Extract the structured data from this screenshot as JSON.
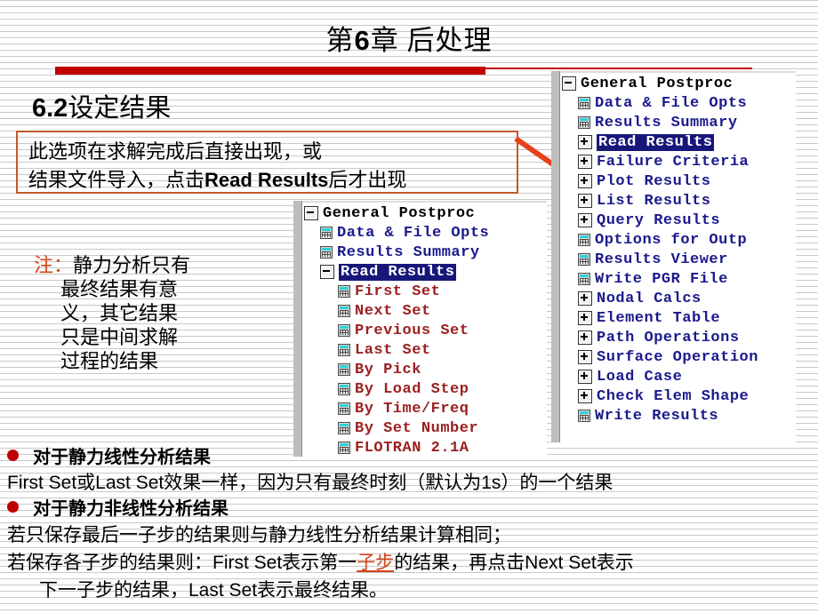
{
  "slide": {
    "title_prefix": "第",
    "title_num": "6",
    "title_suffix": "章 后处理",
    "section_num": "6.2",
    "section_text": "设定结果",
    "accent_red": "#c00000",
    "callout_border": "#c15a2b",
    "arrow_color": "#e8411a"
  },
  "callout": {
    "line1": "此选项在求解完成后直接出现，或",
    "line2_pre": "结果文件导入，点击",
    "line2_bold": "Read Results",
    "line2_post": "后才出现"
  },
  "note": {
    "mark": "注：",
    "line1": "静力分析只有",
    "line2": "最终结果有意",
    "line3": "义，其它结果",
    "line4": "只是中间求解",
    "line5": "过程的结果"
  },
  "middle_tree": {
    "rows": [
      {
        "label": "General Postproc",
        "level": 0,
        "icon": "minus-box",
        "color": "black"
      },
      {
        "label": "Data & File Opts",
        "level": 1,
        "icon": "dialog",
        "color": "blue"
      },
      {
        "label": "Results Summary",
        "level": 1,
        "icon": "dialog",
        "color": "blue"
      },
      {
        "label": "Read Results",
        "level": 1,
        "icon": "minus-box",
        "color": "selected"
      },
      {
        "label": "First Set",
        "level": 2,
        "icon": "dialog",
        "color": "red"
      },
      {
        "label": "Next Set",
        "level": 2,
        "icon": "dialog",
        "color": "red"
      },
      {
        "label": "Previous Set",
        "level": 2,
        "icon": "dialog",
        "color": "red"
      },
      {
        "label": "Last Set",
        "level": 2,
        "icon": "dialog",
        "color": "red"
      },
      {
        "label": "By Pick",
        "level": 2,
        "icon": "dialog",
        "color": "red"
      },
      {
        "label": "By Load Step",
        "level": 2,
        "icon": "dialog",
        "color": "red"
      },
      {
        "label": "By Time/Freq",
        "level": 2,
        "icon": "dialog",
        "color": "red"
      },
      {
        "label": "By Set Number",
        "level": 2,
        "icon": "dialog",
        "color": "red"
      },
      {
        "label": "FLOTRAN 2.1A",
        "level": 2,
        "icon": "dialog",
        "color": "red"
      }
    ]
  },
  "right_tree": {
    "rows": [
      {
        "label": "General Postproc",
        "level": 0,
        "icon": "minus-box",
        "color": "black"
      },
      {
        "label": "Data & File Opts",
        "level": 1,
        "icon": "dialog",
        "color": "blue"
      },
      {
        "label": "Results Summary",
        "level": 1,
        "icon": "dialog",
        "color": "blue"
      },
      {
        "label": "Read Results",
        "level": 1,
        "icon": "plus-box",
        "color": "selected"
      },
      {
        "label": "Failure Criteria",
        "level": 1,
        "icon": "plus-box",
        "color": "blue"
      },
      {
        "label": "Plot Results",
        "level": 1,
        "icon": "plus-box",
        "color": "blue"
      },
      {
        "label": "List Results",
        "level": 1,
        "icon": "plus-box",
        "color": "blue"
      },
      {
        "label": "Query Results",
        "level": 1,
        "icon": "plus-box",
        "color": "blue"
      },
      {
        "label": "Options for Outp",
        "level": 1,
        "icon": "dialog",
        "color": "blue"
      },
      {
        "label": "Results Viewer",
        "level": 1,
        "icon": "dialog",
        "color": "blue"
      },
      {
        "label": "Write PGR File",
        "level": 1,
        "icon": "dialog",
        "color": "blue"
      },
      {
        "label": "Nodal Calcs",
        "level": 1,
        "icon": "plus-box",
        "color": "blue"
      },
      {
        "label": "Element Table",
        "level": 1,
        "icon": "plus-box",
        "color": "blue"
      },
      {
        "label": "Path Operations",
        "level": 1,
        "icon": "plus-box",
        "color": "blue"
      },
      {
        "label": "Surface Operation",
        "level": 1,
        "icon": "plus-box",
        "color": "blue"
      },
      {
        "label": "Load Case",
        "level": 1,
        "icon": "plus-box",
        "color": "blue"
      },
      {
        "label": "Check Elem Shape",
        "level": 1,
        "icon": "plus-box",
        "color": "blue"
      },
      {
        "label": "Write Results",
        "level": 1,
        "icon": "dialog",
        "color": "blue"
      }
    ]
  },
  "body": {
    "bullet1": "对于静力线性分析结果",
    "para1": "First Set或Last Set效果一样，因为只有最终时刻（默认为1s）的一个结果",
    "bullet2": "对于静力非线性分析结果",
    "para2": "若只保存最后一子步的结果则与静力线性分析结果计算相同；",
    "para3_a": "若保存各子步的结果则：First Set表示第一",
    "para3_hl": "子步",
    "para3_b": "的结果，再点击Next Set表示",
    "para4": "下一子步的结果，Last Set表示最终结果。"
  }
}
